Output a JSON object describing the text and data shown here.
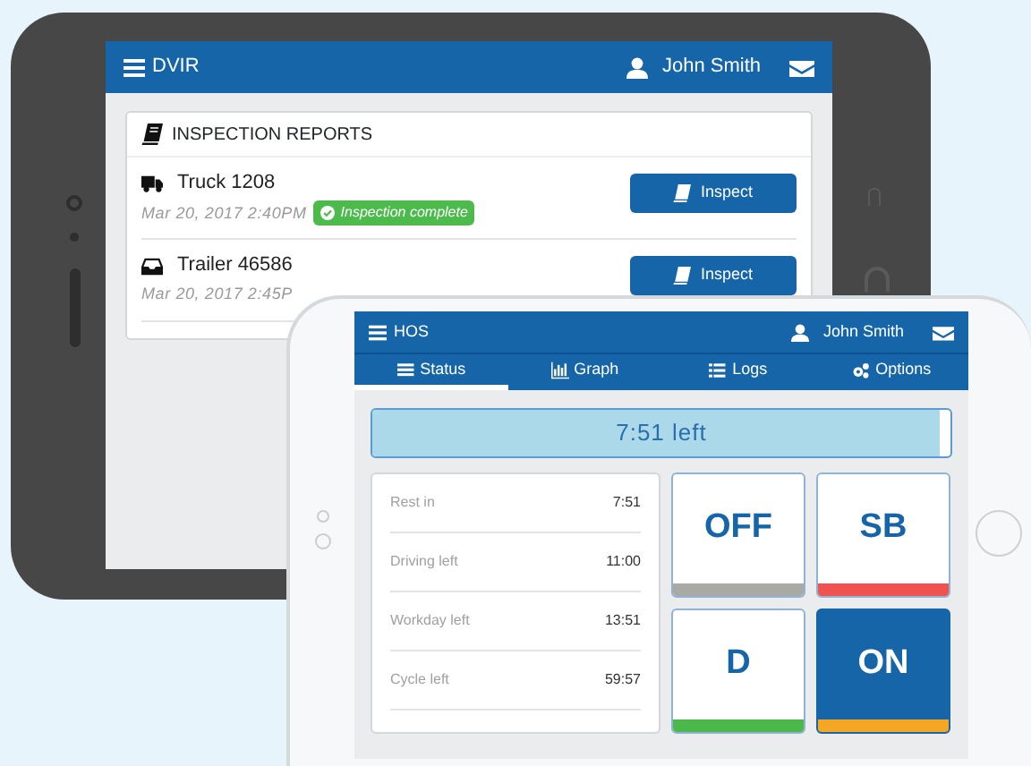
{
  "dvir_tablet": {
    "header": {
      "title": "DVIR",
      "user": "John Smith"
    },
    "card_title": "INSPECTION REPORTS",
    "reports": [
      {
        "kind": "truck",
        "name": "Truck 1208",
        "date": "Mar 20, 2017 2:40PM",
        "complete": true,
        "badge": "Inspection complete",
        "button": "Inspect"
      },
      {
        "kind": "trailer",
        "name": "Trailer 46586",
        "date": "Mar 20, 2017 2:45P",
        "button": "Inspect"
      }
    ]
  },
  "hos_tablet": {
    "header": {
      "title": "HOS",
      "user": "John Smith"
    },
    "tabs": [
      {
        "kind": "status",
        "label": "Status",
        "selected": true
      },
      {
        "kind": "graph",
        "label": "Graph",
        "selected": false
      },
      {
        "kind": "logs",
        "label": "Logs",
        "selected": false
      },
      {
        "kind": "options",
        "label": "Options",
        "selected": false
      }
    ],
    "progress": {
      "label": "7:51 left",
      "level": 0.98
    },
    "stats": [
      {
        "label": "Rest in",
        "value": "7:51"
      },
      {
        "label": "Driving left",
        "value": "11:00"
      },
      {
        "label": "Workday left",
        "value": "13:51"
      },
      {
        "label": "Cycle left",
        "value": "59:57"
      }
    ],
    "duty_tiles": [
      {
        "label": "OFF",
        "color": "#aaaaa5",
        "selected": false
      },
      {
        "label": "SB",
        "color": "#ef5350",
        "selected": false
      },
      {
        "label": "D",
        "color": "#4cb84a",
        "selected": false
      },
      {
        "label": "ON",
        "color": "#f5a623",
        "selected": true
      }
    ]
  }
}
